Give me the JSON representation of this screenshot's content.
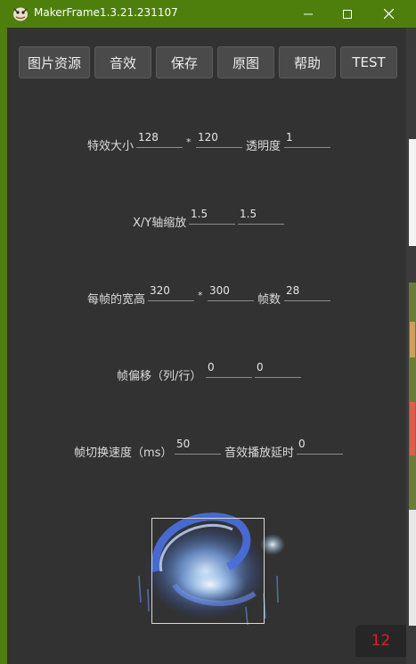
{
  "window": {
    "title": "MakerFrame1.3.21.231107",
    "minimize_label": "—",
    "maximize_label": "□",
    "close_label": "✕"
  },
  "toolbar": {
    "buttons": [
      "图片资源",
      "音效",
      "保存",
      "原图",
      "帮助",
      "TEST"
    ]
  },
  "form": {
    "effect_size_label": "特效大小",
    "effect_width": "128",
    "times": "*",
    "effect_height": "120",
    "opacity_label": "透明度",
    "opacity": "1",
    "scale_label": "X/Y轴缩放",
    "scale_x": "1.5",
    "scale_y": "1.5",
    "frame_size_label": "每帧的宽高",
    "frame_width": "320",
    "frame_height": "300",
    "frame_count_label": "帧数",
    "frame_count": "28",
    "frame_offset_label": "帧偏移（列/行）",
    "offset_col": "0",
    "offset_row": "0",
    "switch_speed_label": "帧切换速度（ms）",
    "switch_speed": "50",
    "sound_delay_label": "音效播放延时",
    "sound_delay": "0"
  },
  "preview": {
    "current_frame": "12"
  },
  "colors": {
    "titlebar": "#4e7f0c",
    "background": "#323232",
    "button": "#4a4a4a",
    "frame_number": "#e02020"
  }
}
